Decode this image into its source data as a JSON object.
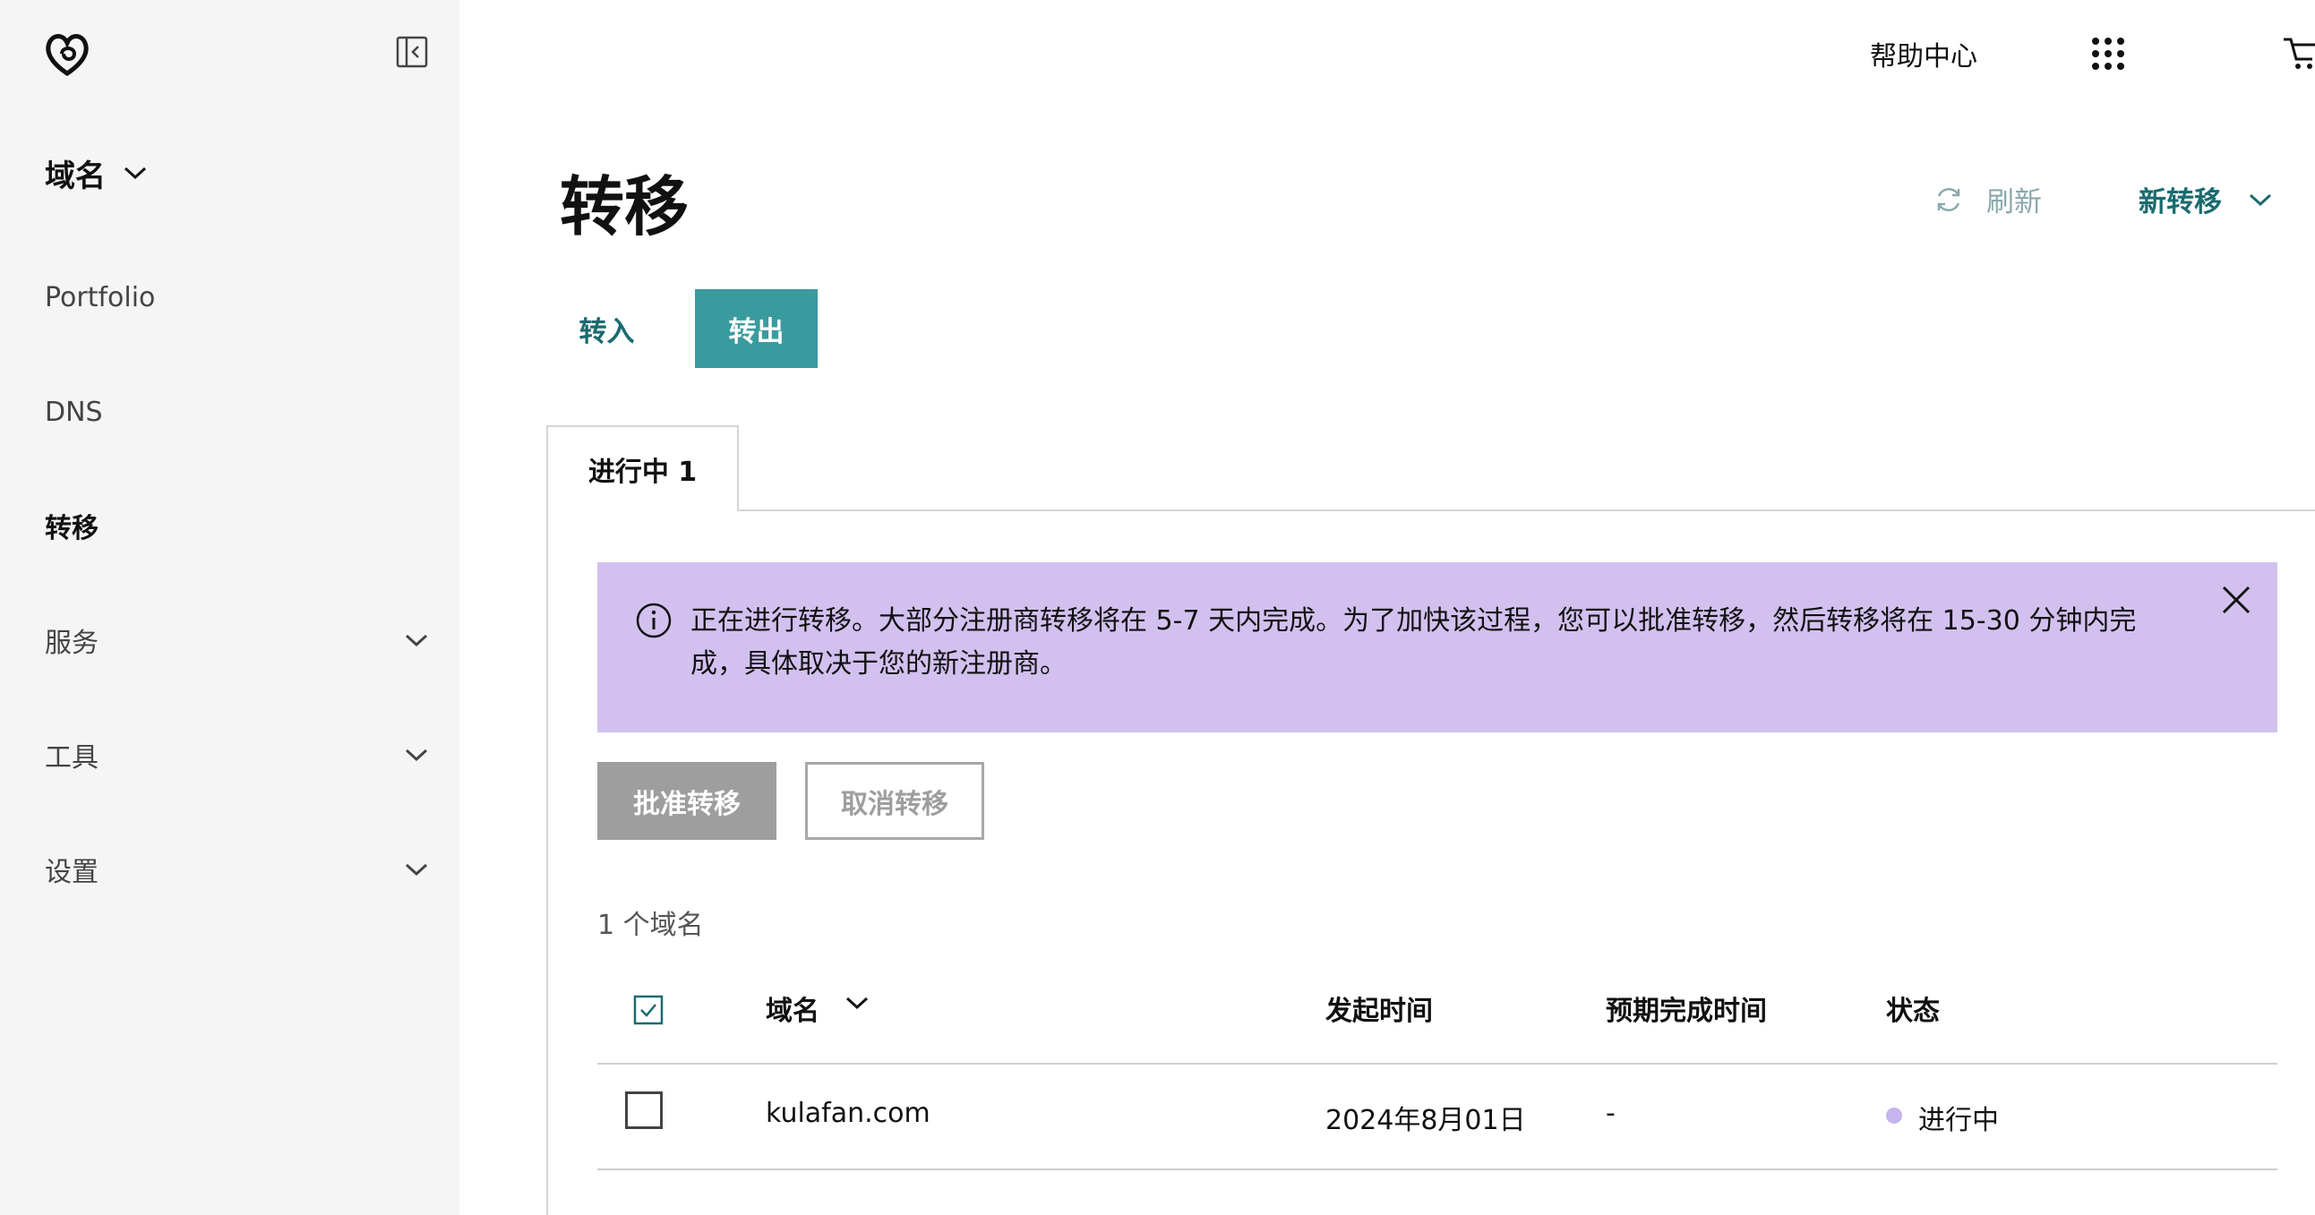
{
  "sidebar": {
    "section": "域名",
    "items": [
      {
        "label": "Portfolio"
      },
      {
        "label": "DNS"
      },
      {
        "label": "转移"
      },
      {
        "label": "服务"
      },
      {
        "label": "工具"
      },
      {
        "label": "设置"
      }
    ]
  },
  "topbar": {
    "help": "帮助中心"
  },
  "header": {
    "title": "转移",
    "refresh": "刷新",
    "new_transfer": "新转移"
  },
  "toggle": {
    "in": "转入",
    "out": "转出"
  },
  "tabs": {
    "active": "进行中 1"
  },
  "alert": {
    "text": "正在进行转移。大部分注册商转移将在 5-7 天内完成。为了加快该过程，您可以批准转移，然后转移将在 15-30 分钟内完成，具体取决于您的新注册商。"
  },
  "actions": {
    "approve": "批准转移",
    "cancel": "取消转移"
  },
  "table": {
    "count": "1 个域名",
    "columns": [
      "域名",
      "发起时间",
      "预期完成时间",
      "状态"
    ],
    "rows": [
      {
        "domain": "kulafan.com",
        "initiated": "2024年8月01日",
        "expected": "-",
        "status": "进行中"
      }
    ]
  },
  "colors": {
    "accent": "#3a9b9f",
    "accent_text": "#1a6b70",
    "alert_bg": "#d2c1ef",
    "status_dot": "#c6b4ee"
  }
}
